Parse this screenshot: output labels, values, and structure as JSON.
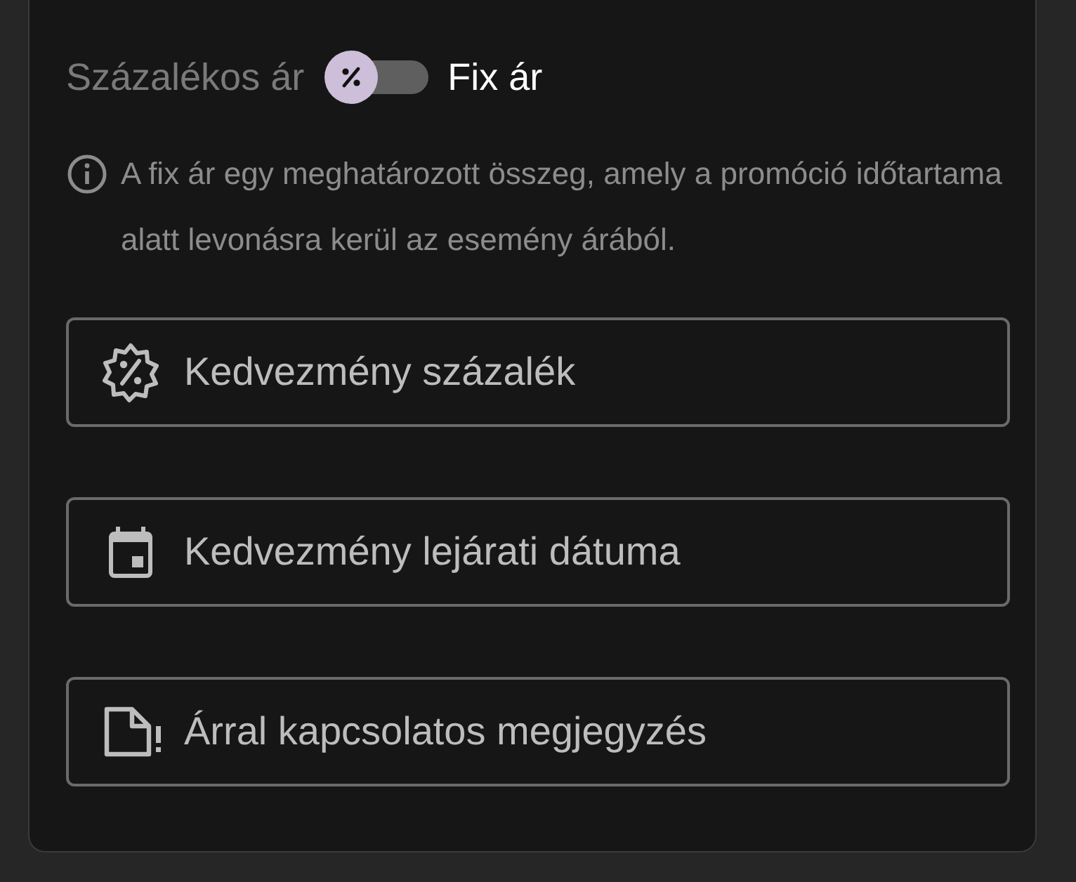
{
  "price_mode": {
    "left_label": "Százalékos ár",
    "right_label": "Fix ár",
    "on": false
  },
  "info": "A fix ár egy meghatározott összeg, amely a promóció időtartama alatt levonásra kerül az esemény árából.",
  "fields": [
    {
      "kind": "percent",
      "placeholder": "Kedvezmény százalék"
    },
    {
      "kind": "calendar",
      "placeholder": "Kedvezmény lejárati dátuma"
    },
    {
      "kind": "note",
      "placeholder": "Árral kapcsolatos megjegyzés"
    }
  ]
}
